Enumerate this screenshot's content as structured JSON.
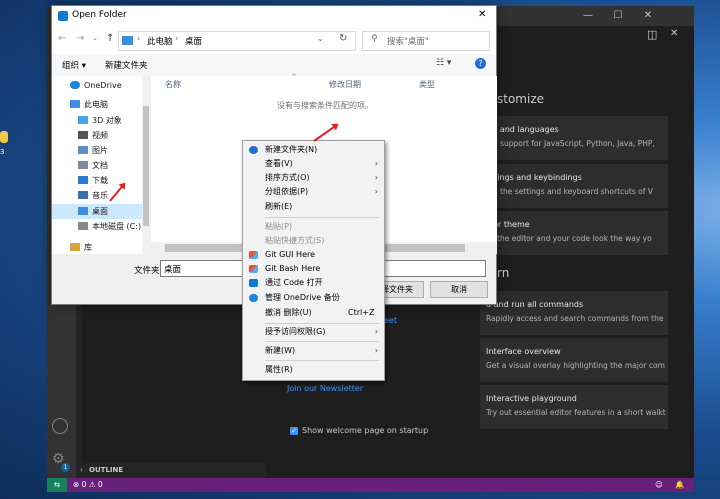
{
  "dialog": {
    "title": "Open Folder",
    "nav_back": "←",
    "nav_forward": "→",
    "nav_up": "↑",
    "breadcrumb": [
      "此电脑",
      "桌面"
    ],
    "search_placeholder": "搜索\"桌面\"",
    "toolbar": {
      "organize": "组织",
      "new_folder": "新建文件夹"
    },
    "sidebar": [
      {
        "label": "OneDrive",
        "icon": "cloud-icon"
      },
      {
        "label": "此电脑",
        "icon": "computer-icon"
      },
      {
        "label": "3D 对象",
        "icon": "cube-icon"
      },
      {
        "label": "视频",
        "icon": "video-icon"
      },
      {
        "label": "图片",
        "icon": "picture-icon"
      },
      {
        "label": "文档",
        "icon": "document-icon"
      },
      {
        "label": "下载",
        "icon": "download-icon"
      },
      {
        "label": "音乐",
        "icon": "music-icon"
      },
      {
        "label": "桌面",
        "icon": "desktop-icon",
        "selected": true
      },
      {
        "label": "本地磁盘 (C:)",
        "icon": "drive-icon"
      },
      {
        "label": "库",
        "icon": "library-icon"
      }
    ],
    "columns": [
      "名称",
      "修改日期",
      "类型"
    ],
    "empty_message": "没有与搜索条件匹配的项。",
    "folder_label": "文件夹:",
    "folder_value": "桌面",
    "select_button": "择文件夹",
    "cancel_button": "取消"
  },
  "context_menu": {
    "items": [
      {
        "label": "新建文件夹(N)",
        "icon": "new-folder-icon"
      },
      {
        "label": "查看(V)",
        "submenu": true
      },
      {
        "label": "排序方式(O)",
        "submenu": true
      },
      {
        "label": "分组依据(P)",
        "submenu": true
      },
      {
        "label": "刷新(E)"
      },
      {
        "separator": true
      },
      {
        "label": "粘贴(P)",
        "disabled": true
      },
      {
        "label": "粘贴快捷方式(S)",
        "disabled": true
      },
      {
        "label": "Git GUI Here",
        "icon": "git-icon"
      },
      {
        "label": "Git Bash Here",
        "icon": "git-icon"
      },
      {
        "label": "通过 Code 打开",
        "icon": "vscode-icon"
      },
      {
        "label": "管理 OneDrive 备份",
        "icon": "onedrive-icon"
      },
      {
        "label": "撤消 删除(U)",
        "shortcut": "Ctrl+Z"
      },
      {
        "separator": true
      },
      {
        "label": "授予访问权限(G)",
        "submenu": true
      },
      {
        "separator": true
      },
      {
        "label": "新建(W)",
        "submenu": true
      },
      {
        "separator": true
      },
      {
        "label": "属性(R)"
      }
    ]
  },
  "vscode": {
    "customize_heading": "stomize",
    "learn_heading": "rn",
    "cards": [
      {
        "title": "ols and languages",
        "desc": "tall support for JavaScript, Python, Java, PHP,"
      },
      {
        "title": "ettings and keybindings",
        "desc": "tall the settings and keyboard shortcuts of V"
      },
      {
        "title": "olor theme",
        "desc": "ke the editor and your code look the way yo"
      },
      {
        "title": "d and run all commands",
        "desc": "Rapidly access and search commands from the"
      },
      {
        "title": "Interface overview",
        "desc": "Get a visual overlay highlighting the major com"
      },
      {
        "title": "Interactive playground",
        "desc": "Try out essential editor features in a short walkt"
      }
    ],
    "tweet_link": "eet",
    "newsletter_link": "Join our Newsletter",
    "show_welcome_label": "Show welcome page on startup",
    "outline_label": "OUTLINE",
    "status_problems": "⊗ 0 ⚠ 0",
    "accounts_badge": "1"
  },
  "desktop_label": "3"
}
